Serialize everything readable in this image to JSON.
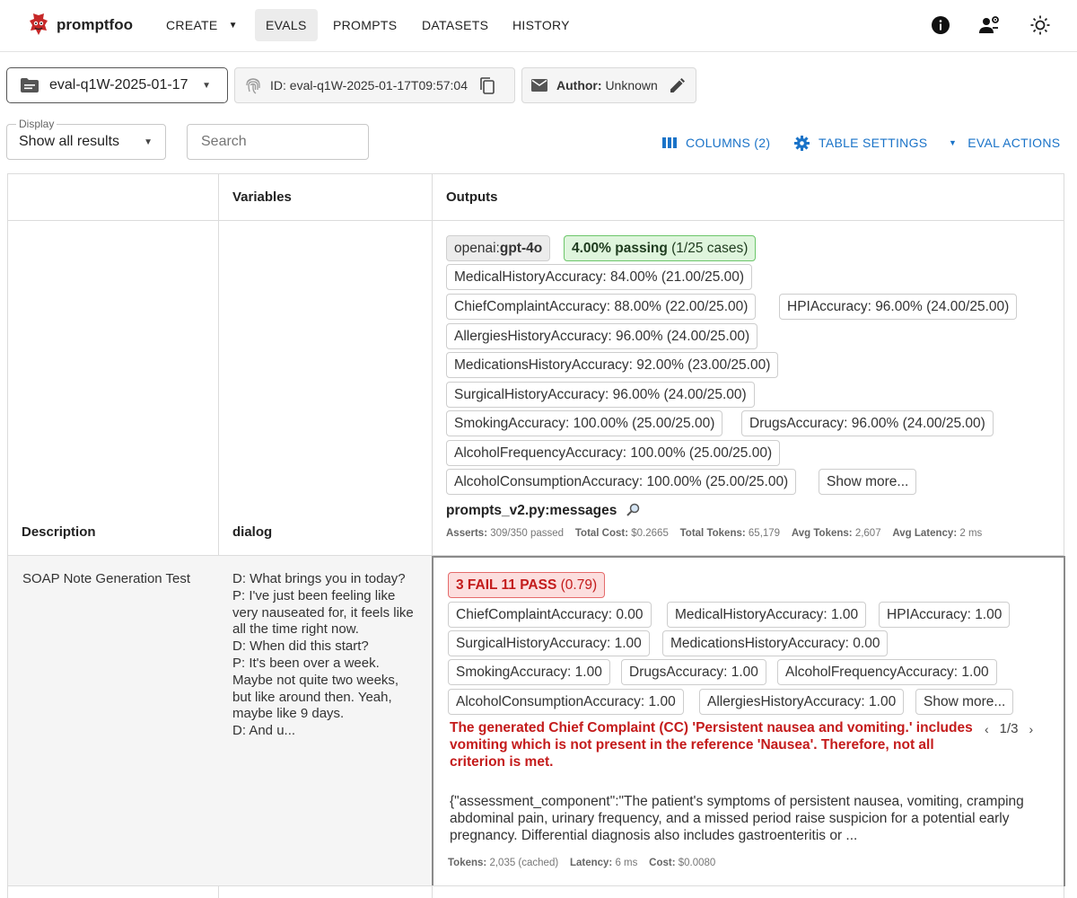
{
  "app": {
    "brand": "promptfoo",
    "nav": {
      "create": "CREATE",
      "evals": "EVALS",
      "prompts": "PROMPTS",
      "datasets": "DATASETS",
      "history": "HISTORY"
    }
  },
  "toolbar": {
    "eval_select": "eval-q1W-2025-01-17",
    "eval_id": "ID: eval-q1W-2025-01-17T09:57:04",
    "author_label": "Author:",
    "author_value": "Unknown",
    "display_label": "Display",
    "display_value": "Show all results",
    "search_placeholder": "Search",
    "columns_btn": "COLUMNS (2)",
    "settings_btn": "TABLE SETTINGS",
    "actions_btn": "EVAL ACTIONS"
  },
  "table": {
    "headers": {
      "variables": "Variables",
      "outputs": "Outputs"
    },
    "subheaders": {
      "description": "Description",
      "dialog": "dialog"
    },
    "summary": {
      "provider_prefix": "openai:",
      "provider_model": "gpt-4o",
      "pass_rate": "4.00% passing",
      "pass_cases": "(1/25 cases)",
      "metrics": [
        "MedicalHistoryAccuracy: 84.00% (21.00/25.00)",
        "ChiefComplaintAccuracy: 88.00% (22.00/25.00)",
        "HPIAccuracy: 96.00% (24.00/25.00)",
        "AllergiesHistoryAccuracy: 96.00% (24.00/25.00)",
        "MedicationsHistoryAccuracy: 92.00% (23.00/25.00)",
        "SurgicalHistoryAccuracy: 96.00% (24.00/25.00)",
        "SmokingAccuracy: 100.00% (25.00/25.00)",
        "DrugsAccuracy: 96.00% (24.00/25.00)",
        "AlcoholFrequencyAccuracy: 100.00% (25.00/25.00)",
        "AlcoholConsumptionAccuracy: 100.00% (25.00/25.00)"
      ],
      "show_more": "Show more...",
      "prompt_name": "prompts_v2.py:messages",
      "stats": {
        "asserts_label": "Asserts:",
        "asserts_value": "309/350 passed",
        "cost_label": "Total Cost:",
        "cost_value": "$0.2665",
        "tokens_label": "Total Tokens:",
        "tokens_value": "65,179",
        "avg_tokens_label": "Avg Tokens:",
        "avg_tokens_value": "2,607",
        "latency_label": "Avg Latency:",
        "latency_value": "2 ms"
      }
    },
    "row": {
      "description": "SOAP Note Generation Test",
      "dialog": "D: What brings you in today?\nP: I've just been feeling like very nauseated for, it feels like all the time right now.\nD: When did this start?\nP: It's been over a week. Maybe not quite two weeks, but like around then. Yeah, maybe like 9 days.\nD: And u...",
      "result_badge": "3 FAIL 11 PASS",
      "result_score": "(0.79)",
      "scores": [
        "ChiefComplaintAccuracy: 0.00",
        "MedicalHistoryAccuracy: 1.00",
        "HPIAccuracy: 1.00",
        "SurgicalHistoryAccuracy: 1.00",
        "MedicationsHistoryAccuracy: 0.00",
        "SmokingAccuracy: 1.00",
        "DrugsAccuracy: 1.00",
        "AlcoholFrequencyAccuracy: 1.00",
        "AlcoholConsumptionAccuracy: 1.00",
        "AllergiesHistoryAccuracy: 1.00"
      ],
      "show_more": "Show more...",
      "fail_reason": "The generated Chief Complaint (CC) 'Persistent nausea and vomiting.' includes vomiting which is not present in the reference 'Nausea'. Therefore, not all criterion is met.",
      "pager": "1/3",
      "output": "{\"assessment_component\":\"The patient's symptoms of persistent nausea, vomiting, cramping abdominal pain, urinary frequency, and a missed period raise suspicion for a potential early pregnancy. Differential diagnosis also includes gastroenteritis or ...",
      "stats": {
        "tokens_label": "Tokens:",
        "tokens_value": "2,035 (cached)",
        "latency_label": "Latency:",
        "latency_value": "6 ms",
        "cost_label": "Cost:",
        "cost_value": "$0.0080"
      }
    }
  },
  "colors": {
    "accent": "#1a73c8",
    "pass_bg": "#dff5dd",
    "pass_border": "#6cc66a",
    "fail_bg": "#fcdede",
    "fail_text": "#c41b1b"
  }
}
